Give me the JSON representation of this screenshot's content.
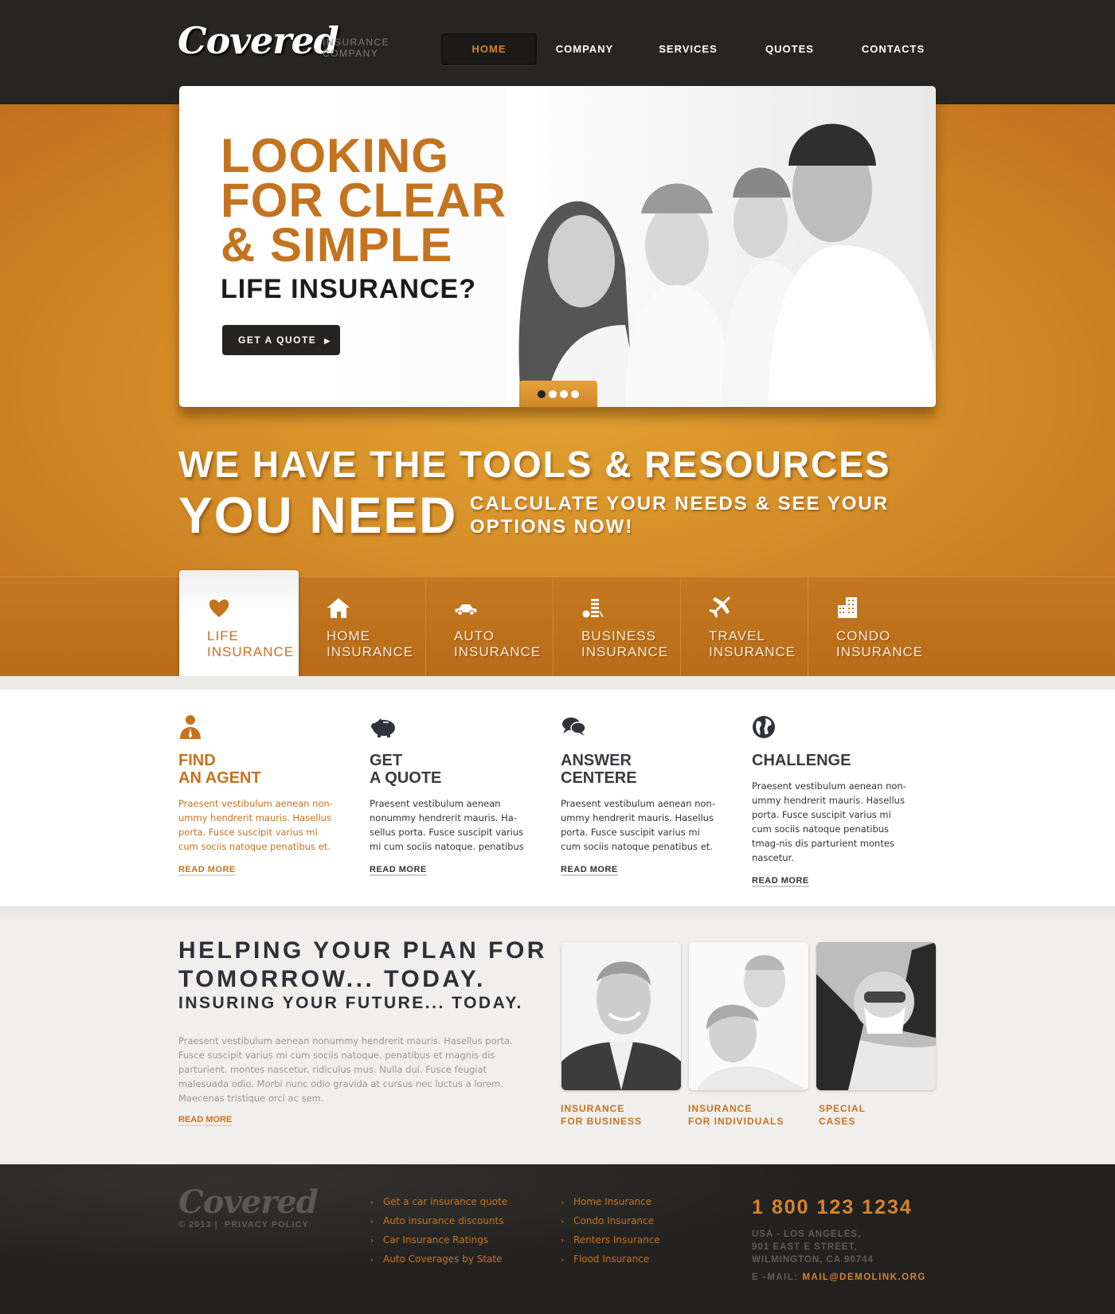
{
  "brand": {
    "logo": "Covered",
    "tagline_line1": "INSURANCE",
    "tagline_line2": "COMPANY"
  },
  "nav": {
    "items": [
      {
        "label": "HOME",
        "active": true
      },
      {
        "label": "COMPANY"
      },
      {
        "label": "SERVICES"
      },
      {
        "label": "QUOTES"
      },
      {
        "label": "CONTACTS"
      }
    ]
  },
  "slider": {
    "headline_line1": "LOOKING",
    "headline_line2": "FOR CLEAR",
    "headline_line3": "& SIMPLE",
    "subheadline": "LIFE INSURANCE?",
    "button_label": "GET A QUOTE",
    "image_alt": "Smiling family of four",
    "slides_total": 4,
    "active_slide": 1
  },
  "tools": {
    "line1": "WE HAVE THE TOOLS & RESOURCES",
    "line2": "YOU NEED",
    "aside_line1": "CALCULATE YOUR NEEDS & SEE YOUR",
    "aside_line2": "OPTIONS NOW!"
  },
  "insurance_tabs": [
    {
      "line1": "LIFE",
      "line2": "INSURANCE",
      "icon": "heart-icon",
      "active": true
    },
    {
      "line1": "HOME",
      "line2": "INSURANCE",
      "icon": "house-icon"
    },
    {
      "line1": "AUTO",
      "line2": "INSURANCE",
      "icon": "car-icon"
    },
    {
      "line1": "BUSINESS",
      "line2": "INSURANCE",
      "icon": "coins-icon"
    },
    {
      "line1": "TRAVEL",
      "line2": "INSURANCE",
      "icon": "airplane-icon"
    },
    {
      "line1": "CONDO",
      "line2": "INSURANCE",
      "icon": "buildings-icon"
    }
  ],
  "services": [
    {
      "title_line1": "FIND",
      "title_line2": "AN AGENT",
      "icon": "agent-icon",
      "text": "Praesent vestibulum aenean non-ummy hendrerit mauris. Hasellus porta. Fusce suscipit varius mi cum sociis natoque penatibus et.",
      "link": "READ MORE"
    },
    {
      "title_line1": "GET",
      "title_line2": "A QUOTE",
      "icon": "piggy-bank-icon",
      "text": "Praesent vestibulum aenean nonummy hendrerit mauris. Ha-sellus porta. Fusce suscipit varius mi cum sociis natoque. penatibus",
      "link": "READ MORE"
    },
    {
      "title_line1": "ANSWER",
      "title_line2": "CENTERE",
      "icon": "chat-bubbles-icon",
      "text": "Praesent vestibulum aenean non-ummy hendrerit mauris. Hasellus porta. Fusce suscipit varius mi cum sociis natoque penatibus et.",
      "link": "READ MORE"
    },
    {
      "title_line1": "CHALLENGE",
      "title_line2": "",
      "icon": "globe-icon",
      "text": "Praesent vestibulum aenean non-ummy hendrerit mauris. Hasellus porta. Fusce suscipit varius mi cum sociis natoque penatibus tmag-nis dis parturient montes nascetur.",
      "link": "READ MORE"
    }
  ],
  "plan": {
    "title_line1": "HELPING YOUR PLAN FOR",
    "title_line2": "TOMORROW... TODAY.",
    "subtitle": "INSURING YOUR FUTURE... TODAY.",
    "text": "Praesent vestibulum aenean nonummy hendrerit mauris. Hasellus porta. Fusce suscipit varius mi cum sociis natoque. penatibus et magnis dis parturient. montes nascetur. ridiculus mus. Nulla dui. Fusce feugiat malesuada odio. Morbi nunc odio gravida at cursus nec luctus a lorem. Maecenas tristique orci ac sem.",
    "link": "READ MORE",
    "cards": [
      {
        "line1": "INSURANCE",
        "line2": "FOR BUSINESS",
        "image_alt": "Smiling businessman"
      },
      {
        "line1": "INSURANCE",
        "line2": "FOR INDIVIDUALS",
        "image_alt": "Mother and child"
      },
      {
        "line1": "SPECIAL",
        "line2": "CASES",
        "image_alt": "Skydiver in helmet"
      }
    ]
  },
  "footer": {
    "logo": "Covered",
    "copyright": "© 2013 |",
    "privacy": "PRIVACY POLICY",
    "links_col1": [
      "Get a car insurance quote",
      "Auto insurance discounts",
      "Car Insurance Ratings",
      "Auto Coverages by State"
    ],
    "links_col2": [
      "Home Insurance",
      "Condo Insurance",
      "Renters Insurance",
      "Flood Insurance"
    ],
    "phone": "1 800 123 1234",
    "address_line1": "USA - LOS ANGELES,",
    "address_line2": "901 EAST E STREET,",
    "address_line3": "WILMINGTON, CA 90744",
    "email_label": "E -MAIL:",
    "email": "MAIL@DEMOLINK.ORG"
  },
  "colors": {
    "accent": "#c4731f",
    "header_bg": "#262523",
    "dark_text": "#2e3036"
  }
}
